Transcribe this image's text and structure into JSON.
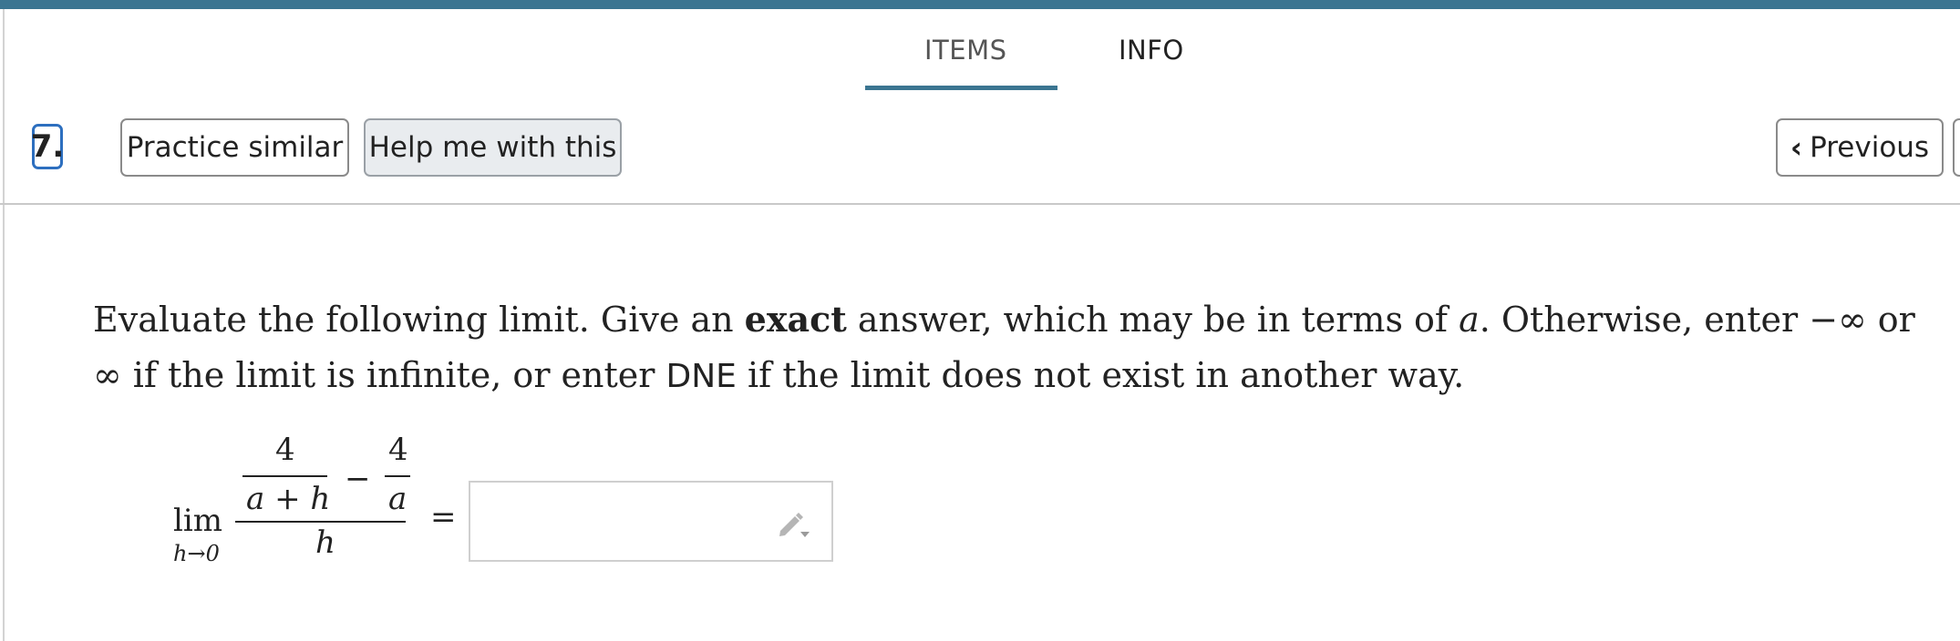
{
  "tabs": {
    "items": "ITEMS",
    "info": "INFO"
  },
  "toolbar": {
    "question_number": "7.",
    "practice_label": "Practice similar",
    "help_label": "Help me with this",
    "prev_label": "Previous"
  },
  "question": {
    "part1": "Evaluate the following limit. Give an ",
    "bold": "exact",
    "part2": " answer, which may be in terms of ",
    "var": "a",
    "part3": ". Otherwise, enter −∞ or ∞ if the limit is infinite, or enter ",
    "dne": "DNE",
    "part4": " if the limit does not exist in another way."
  },
  "math": {
    "lim": "lim",
    "sub": "h→0",
    "num1": "4",
    "den1": "a + h",
    "minus": "−",
    "num2": "4",
    "den2": "a",
    "den_main": "h",
    "equals": "="
  },
  "answer": {
    "value": ""
  },
  "colors": {
    "accent": "#3b7591",
    "focus": "#2d6fbf"
  },
  "icons": {
    "prev": "chevron-left-icon",
    "edit": "pencil-icon"
  }
}
